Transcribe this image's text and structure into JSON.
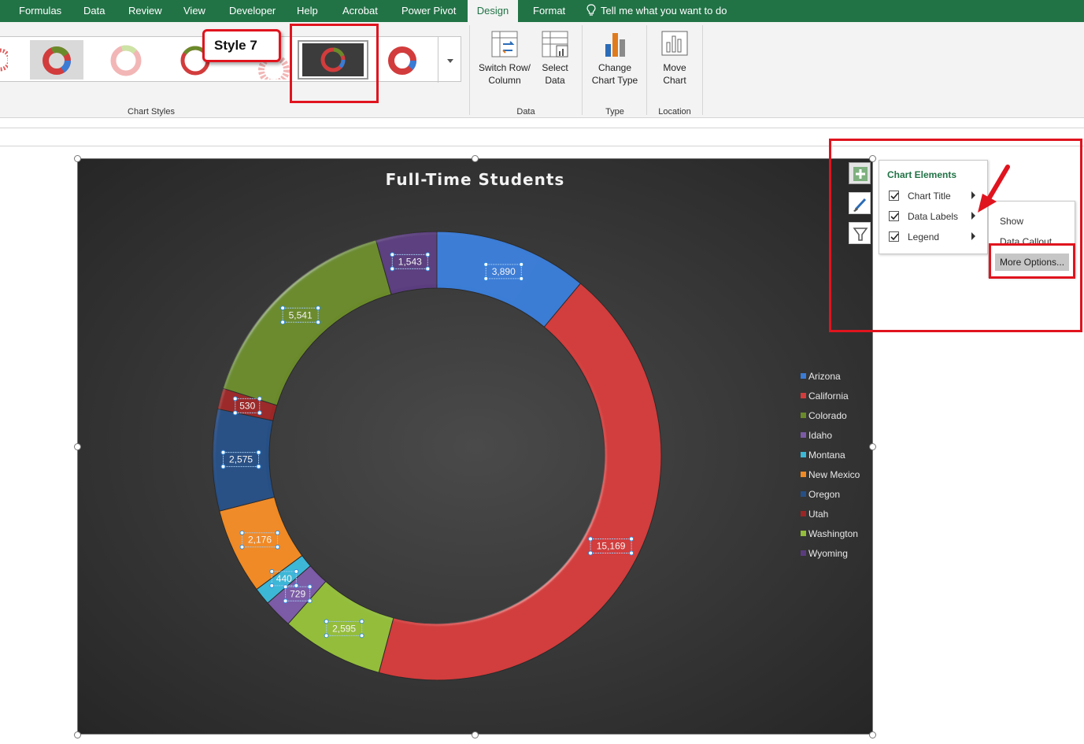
{
  "tabs": [
    "Formulas",
    "Data",
    "Review",
    "View",
    "Developer",
    "Help",
    "Acrobat",
    "Power Pivot",
    "Design",
    "Format"
  ],
  "active_tab": "Design",
  "tell_me": "Tell me what you want to do",
  "ribbon": {
    "chart_styles_label": "Chart Styles",
    "style_callout": "Style 7",
    "switch_row_column": [
      "Switch Row/",
      "Column"
    ],
    "select_data": [
      "Select",
      "Data"
    ],
    "data_group_label": "Data",
    "change_chart_type": [
      "Change",
      "Chart Type"
    ],
    "type_group_label": "Type",
    "move_chart": [
      "Move",
      "Chart"
    ],
    "location_group_label": "Location"
  },
  "chart_data": {
    "type": "pie",
    "title": "Full-Time Students",
    "categories": [
      "Arizona",
      "California",
      "Colorado",
      "Idaho",
      "Montana",
      "New Mexico",
      "Oregon",
      "Utah",
      "Washington",
      "Wyoming"
    ],
    "values": [
      3890,
      15169,
      2595,
      729,
      440,
      2176,
      2575,
      530,
      5541,
      1543
    ],
    "slice_order": [
      "Arizona",
      "California",
      "Washington",
      "Idaho",
      "Montana",
      "New Mexico",
      "Oregon",
      "Utah",
      "Colorado",
      "Wyoming"
    ],
    "slice_values": [
      3890,
      15169,
      2595,
      729,
      440,
      2176,
      2575,
      530,
      5541,
      1543
    ],
    "data_labels": [
      "3,890",
      "15,169",
      "2,595",
      "729",
      "440",
      "2,176",
      "2,575",
      "530",
      "5,541",
      "1,543"
    ],
    "colors": {
      "Arizona": "#3a7bd5",
      "California": "#d23c3c",
      "Colorado": "#6a8a2a",
      "Idaho": "#7b5aa6",
      "Montana": "#3cb7d6",
      "New Mexico": "#f08a24",
      "Oregon": "#254f85",
      "Utah": "#9b2525",
      "Washington": "#93bd3a",
      "Wyoming": "#5a3c7e"
    },
    "legend": [
      "Arizona",
      "California",
      "Colorado",
      "Idaho",
      "Montana",
      "New Mexico",
      "Oregon",
      "Utah",
      "Washington",
      "Wyoming"
    ],
    "legend_position": "right",
    "donut": true
  },
  "chart_elements": {
    "title": "Chart Elements",
    "items": [
      {
        "label": "Chart Title",
        "checked": true
      },
      {
        "label": "Data Labels",
        "checked": true
      },
      {
        "label": "Legend",
        "checked": true
      }
    ]
  },
  "data_labels_submenu": {
    "show": "Show",
    "data_callout": "Data Callout",
    "more_options": "More Options..."
  }
}
